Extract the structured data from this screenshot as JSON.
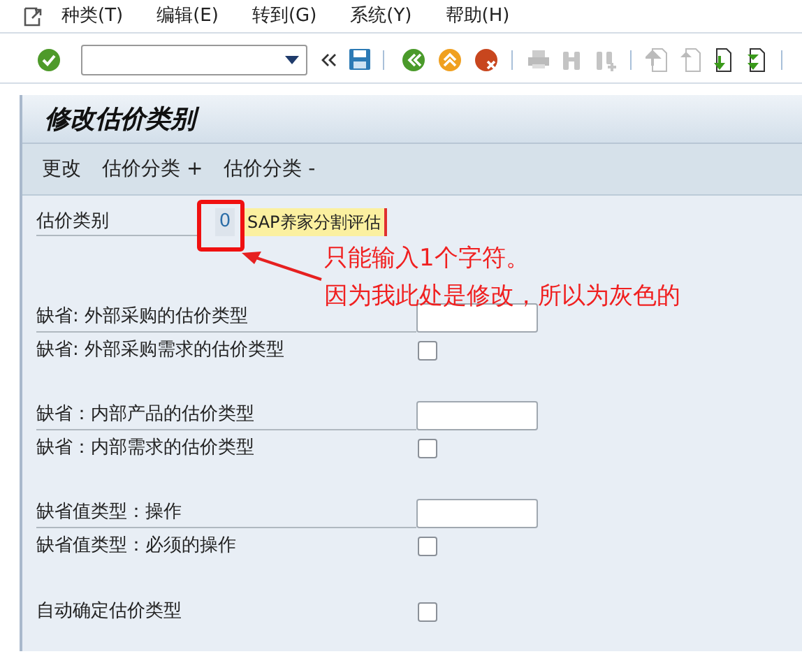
{
  "menu_bar": {
    "items": [
      {
        "label": "种类(T)"
      },
      {
        "label": "编辑(E)"
      },
      {
        "label": "转到(G)"
      },
      {
        "label": "系统(Y)"
      },
      {
        "label": "帮助(H)"
      }
    ]
  },
  "screen_title": "修改估价类别",
  "app_toolbar": {
    "buttons": [
      "更改",
      "估价分类 +",
      "估价分类 -"
    ]
  },
  "key_field": {
    "label": "估价类别",
    "value": "0",
    "disabled": true,
    "description": "SAP养家分割评估"
  },
  "groups": [
    {
      "rows": [
        {
          "kind": "input",
          "label": "缺省: 外部采购的估价类型"
        },
        {
          "kind": "checkbox",
          "label": "缺省: 外部采购需求的估价类型",
          "checked": false
        }
      ]
    },
    {
      "rows": [
        {
          "kind": "input",
          "label": "缺省：内部产品的估价类型"
        },
        {
          "kind": "checkbox",
          "label": "缺省：内部需求的估价类型",
          "checked": false
        }
      ]
    },
    {
      "rows": [
        {
          "kind": "input",
          "label": "缺省值类型：操作"
        },
        {
          "kind": "checkbox",
          "label": "缺省值类型：必须的操作",
          "checked": false
        }
      ]
    },
    {
      "rows": [
        {
          "kind": "checkbox",
          "label": "自动确定估价类型",
          "checked": false
        }
      ]
    }
  ],
  "annotation": {
    "lines": [
      "只能输入1个字符。",
      "因为我此处是修改，所以为灰色的"
    ]
  }
}
